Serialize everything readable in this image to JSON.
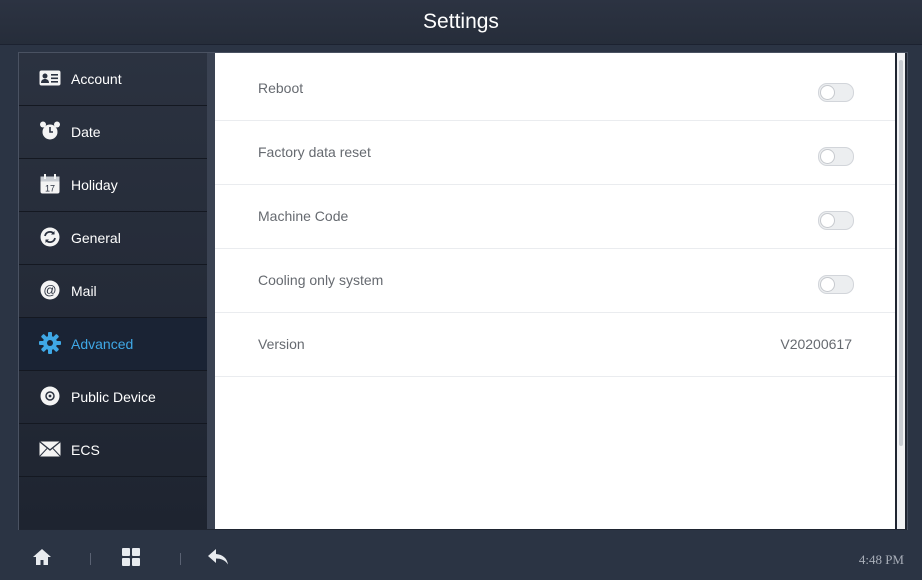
{
  "title": "Settings",
  "sidebar": {
    "items": [
      {
        "label": "Account",
        "icon": "contact-card-icon"
      },
      {
        "label": "Date",
        "icon": "alarm-clock-icon"
      },
      {
        "label": "Holiday",
        "icon": "calendar-icon"
      },
      {
        "label": "General",
        "icon": "refresh-icon"
      },
      {
        "label": "Mail",
        "icon": "at-sign-icon"
      },
      {
        "label": "Advanced",
        "icon": "gear-icon",
        "active": true
      },
      {
        "label": "Public Device",
        "icon": "device-icon"
      },
      {
        "label": "ECS",
        "icon": "envelope-icon"
      }
    ]
  },
  "settings": {
    "rows": [
      {
        "label": "Reboot",
        "type": "toggle",
        "state": "off"
      },
      {
        "label": "Factory data reset",
        "type": "toggle",
        "state": "off"
      },
      {
        "label": "Machine Code",
        "type": "toggle",
        "state": "off"
      },
      {
        "label": "Cooling only system",
        "type": "toggle",
        "state": "off"
      },
      {
        "label": "Version",
        "type": "value",
        "value": "V20200617"
      }
    ]
  },
  "bottom": {
    "time": "4:48 PM",
    "icons": [
      "home-icon",
      "grid-icon",
      "back-icon"
    ]
  },
  "colors": {
    "accent": "#3fa8e6",
    "background": "#2b3444",
    "panel": "#ffffff"
  }
}
